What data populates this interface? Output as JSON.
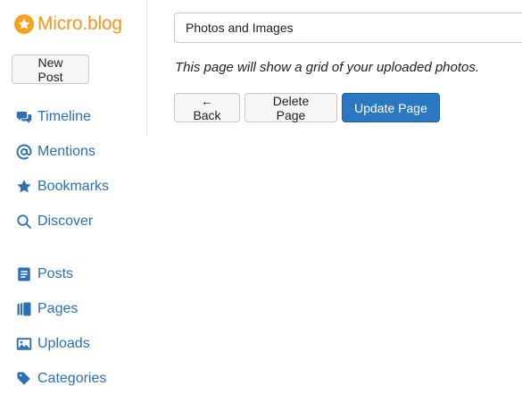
{
  "brand": {
    "name": "Micro.blog",
    "logo_icon": "star-icon",
    "accent": "#f7941d"
  },
  "sidebar": {
    "new_post_label": "New Post",
    "items": [
      {
        "key": "timeline",
        "label": "Timeline",
        "icon": "speech-bubbles-icon"
      },
      {
        "key": "mentions",
        "label": "Mentions",
        "icon": "at-sign-icon"
      },
      {
        "key": "bookmarks",
        "label": "Bookmarks",
        "icon": "star-icon"
      },
      {
        "key": "discover",
        "label": "Discover",
        "icon": "search-icon"
      },
      {
        "key": "posts",
        "label": "Posts",
        "icon": "document-icon"
      },
      {
        "key": "pages",
        "label": "Pages",
        "icon": "book-icon"
      },
      {
        "key": "uploads",
        "label": "Uploads",
        "icon": "image-icon"
      },
      {
        "key": "categories",
        "label": "Categories",
        "icon": "tag-icon"
      }
    ],
    "link_color": "#2b6fb4"
  },
  "editor": {
    "title_value": "Photos and Images",
    "description": "This page will show a grid of your uploaded photos.",
    "back_label": "← Back",
    "delete_label": "Delete Page",
    "update_label": "Update Page",
    "primary_color": "#2b78c2"
  }
}
